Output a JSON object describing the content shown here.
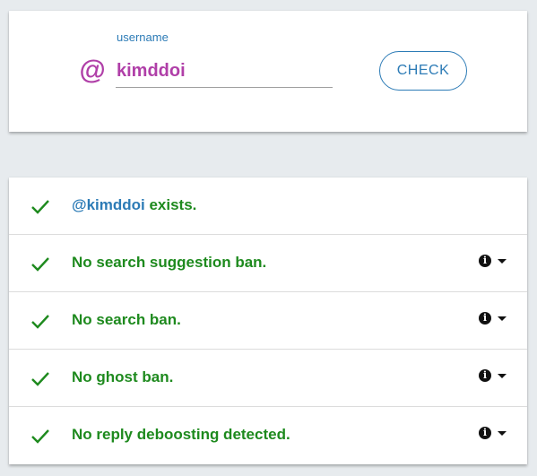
{
  "search": {
    "at_symbol": "@",
    "label": "username",
    "value": "kimddoi",
    "button_label": "CHECK"
  },
  "colors": {
    "accent": "#2c7bb6",
    "handle": "#b03fa8",
    "success": "#1e8a1e",
    "background": "#e7ebee"
  },
  "results": {
    "exists": {
      "handle": "@kimddoi",
      "suffix": " exists.",
      "icon": "check-icon"
    },
    "suggestion_ban": {
      "text": "No search suggestion ban.",
      "icon": "check-icon",
      "info_icon": "info-icon",
      "dropdown_icon": "caret-down-icon"
    },
    "search_ban": {
      "text": "No search ban.",
      "icon": "check-icon",
      "info_icon": "info-icon",
      "dropdown_icon": "caret-down-icon"
    },
    "ghost_ban": {
      "text": "No ghost ban.",
      "icon": "check-icon",
      "info_icon": "info-icon",
      "dropdown_icon": "caret-down-icon"
    },
    "reply_deboosting": {
      "text": "No reply deboosting detected.",
      "icon": "check-icon",
      "info_icon": "info-icon",
      "dropdown_icon": "caret-down-icon"
    }
  }
}
